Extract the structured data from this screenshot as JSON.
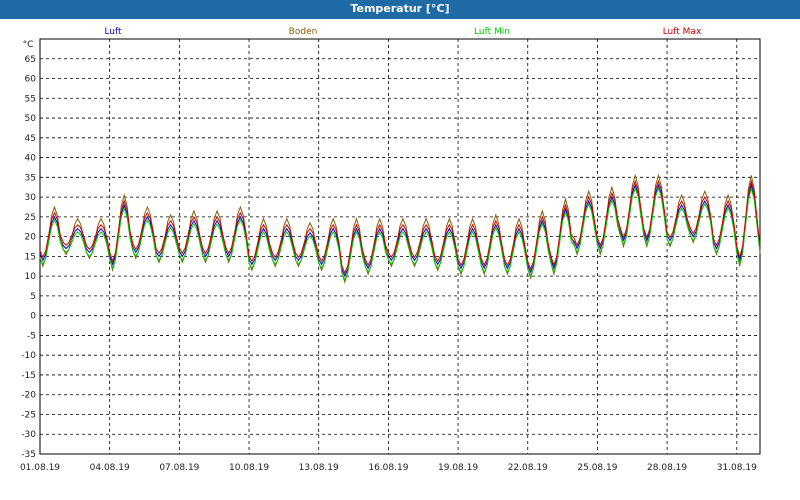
{
  "window": {
    "title": "Temperatur [°C]"
  },
  "chart_data": {
    "type": "line",
    "title": "Temperatur [°C]",
    "ylabel": "°C",
    "ylim": [
      -35,
      70
    ],
    "yticks": [
      65,
      60,
      55,
      50,
      45,
      40,
      35,
      30,
      25,
      20,
      15,
      10,
      5,
      0,
      -5,
      -10,
      -15,
      -20,
      -25,
      -30,
      -35
    ],
    "xlim": [
      "01.08.19",
      "01.09.19"
    ],
    "xticks": [
      "01.08.19",
      "04.08.19",
      "07.08.19",
      "10.08.19",
      "13.08.19",
      "16.08.19",
      "19.08.19",
      "22.08.19",
      "25.08.19",
      "28.08.19",
      "31.08.19"
    ],
    "grid": true,
    "legend_position": "top",
    "daily_min": [
      14,
      17,
      16,
      13,
      16,
      15,
      15,
      15,
      15,
      13,
      14,
      14,
      13,
      10,
      12,
      14,
      14,
      13,
      12,
      12,
      12,
      11,
      12,
      17,
      17,
      19,
      19,
      19,
      20,
      17,
      14,
      20
    ],
    "daily_max": [
      25,
      22,
      22,
      28,
      25,
      23,
      24,
      24,
      25,
      22,
      22,
      21,
      22,
      22,
      22,
      22,
      22,
      22,
      22,
      23,
      22,
      24,
      27,
      29,
      30,
      33,
      33,
      28,
      29,
      28,
      33,
      33
    ],
    "series": [
      {
        "name": "Luft",
        "color": "#0000cc",
        "offset_min": 0,
        "offset_max": 0
      },
      {
        "name": "Boden",
        "color": "#8b5a00",
        "offset_min": -1.5,
        "offset_max": 2.5
      },
      {
        "name": "Luft Min",
        "color": "#00cc00",
        "offset_min": -1,
        "offset_max": -0.8
      },
      {
        "name": "Luft Max",
        "color": "#cc0000",
        "offset_min": 0.8,
        "offset_max": 1
      }
    ]
  }
}
